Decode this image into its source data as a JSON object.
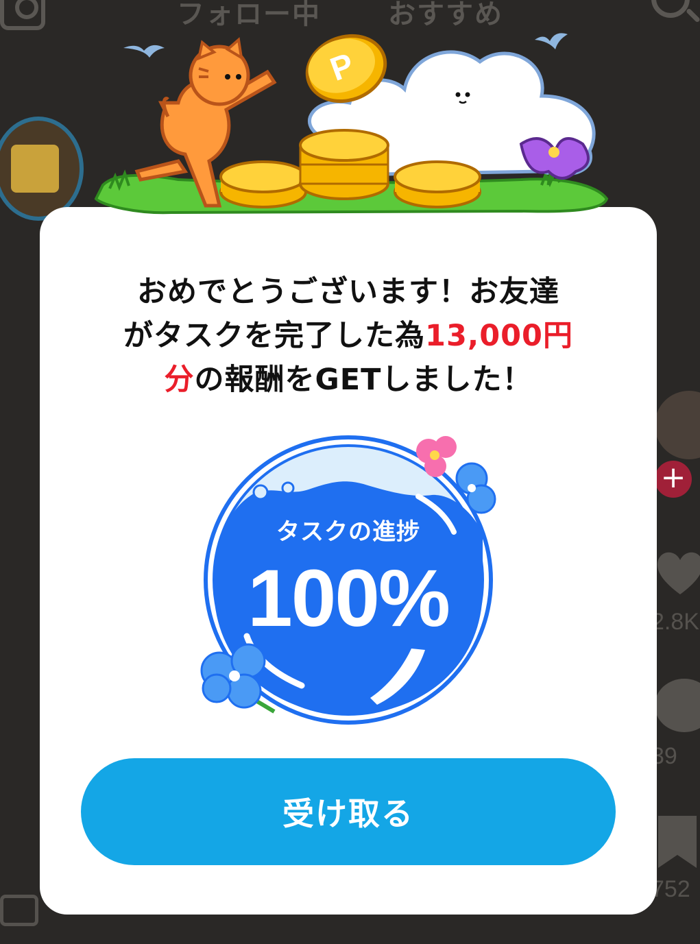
{
  "background": {
    "tabs": [
      "フォロー中",
      "おすすめ"
    ],
    "side_counts": {
      "likes": "2.8K",
      "comments": "39",
      "bookmarks": "752"
    }
  },
  "modal": {
    "message_parts": {
      "line1": "おめでとうございます！お友達",
      "line2_a": "がタスクを完了した為",
      "amount": "13,000円",
      "amount_suffix": "分",
      "line3_b": "の報酬をGETしました！"
    },
    "progress": {
      "label": "タスクの進捗",
      "value_text": "100%",
      "value": 100
    },
    "receive_button": "受け取る"
  },
  "illustration": {
    "coin_letter": "P"
  },
  "colors": {
    "accent_red": "#ea1e2a",
    "button_blue": "#14a6e6",
    "progress_blue": "#1f6ff0",
    "overlay": "#2a2826"
  }
}
